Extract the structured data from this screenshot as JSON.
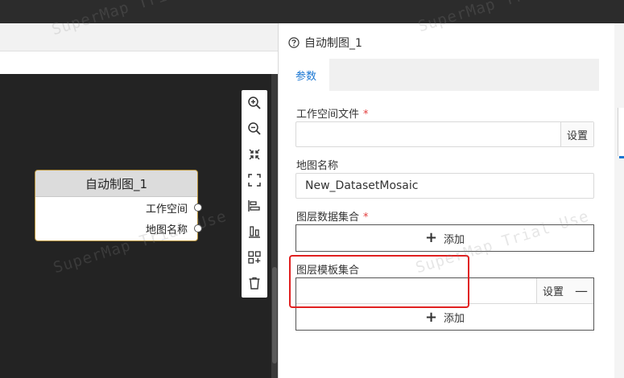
{
  "panel": {
    "title": "自动制图_1",
    "help_icon": "help-circle-icon",
    "tabs": [
      {
        "label": "参数",
        "active": true
      }
    ],
    "fields": {
      "workspace_file": {
        "label": "工作空间文件",
        "required_mark": "*",
        "value": "",
        "button": "设置"
      },
      "map_name": {
        "label": "地图名称",
        "value": "New_DatasetMosaic"
      },
      "layer_datasets": {
        "label": "图层数据集合",
        "required_mark": "*",
        "add_label": "添加"
      },
      "layer_templates": {
        "label": "图层模板集合",
        "value": "",
        "button": "设置",
        "remove_symbol": "—",
        "add_label": "添加"
      }
    }
  },
  "node": {
    "title": "自动制图_1",
    "ports": [
      "工作空间",
      "地图名称"
    ]
  },
  "toolbar": {
    "tools": [
      {
        "name": "zoom-in-icon"
      },
      {
        "name": "zoom-out-icon"
      },
      {
        "name": "fit-screen-icon"
      },
      {
        "name": "fullscreen-icon"
      },
      {
        "name": "align-horizontal-icon"
      },
      {
        "name": "align-vertical-icon"
      },
      {
        "name": "layout-icon"
      },
      {
        "name": "delete-icon"
      }
    ]
  },
  "watermark": {
    "text": "SuperMap Trial Use"
  },
  "colors": {
    "accent": "#1976d2",
    "node_border": "#b9943b",
    "required": "#e23c3c",
    "highlight": "#e02020"
  }
}
